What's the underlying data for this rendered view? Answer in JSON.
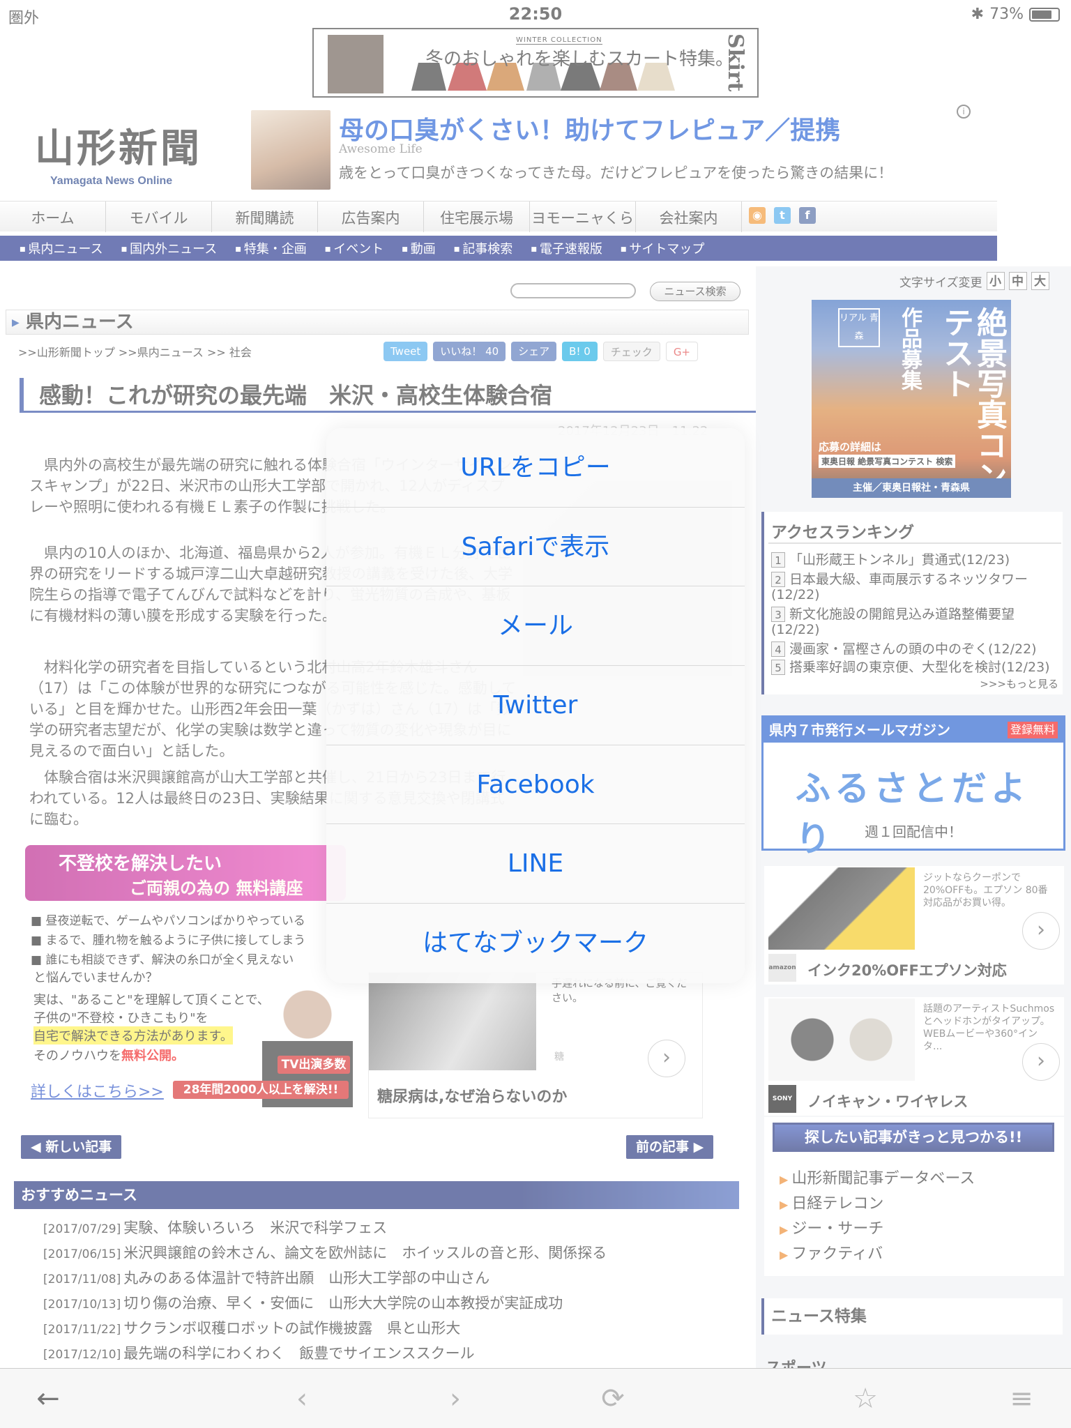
{
  "status_bar": {
    "carrier": "圏外",
    "time": "22:50",
    "battery": "73%"
  },
  "top_ad": {
    "collection": "WINTER COLLECTION",
    "title": "冬のおしゃれを楽しむスカート特集。",
    "side_text": "Skirt"
  },
  "header": {
    "logo_jp": "山形新聞",
    "logo_en": "Yamagata News Online",
    "ad": {
      "headline": "母の口臭がくさい！助けてフレピュア／提携",
      "source": "Awesome Life",
      "description": "歳をとって口臭がきつくなってきた母。だけどフレピュアを使ったら驚きの結果に！"
    }
  },
  "main_nav": [
    "ホーム",
    "モバイル",
    "新聞購読",
    "広告案内",
    "住宅展示場",
    "ヨモーニャくらぶ",
    "会社案内"
  ],
  "sub_nav": [
    "県内ニュース",
    "国内外ニュース",
    "特集・企画",
    "イベント",
    "動画",
    "記事検索",
    "電子速報版",
    "サイトマップ"
  ],
  "search": {
    "button": "ニュース検索"
  },
  "section_title": "県内ニュース",
  "breadcrumb": ">>山形新聞トップ >>県内ニュース >> 社会",
  "share_buttons": {
    "tweet": "Tweet",
    "like": "いいね！ 40",
    "share": "シェア",
    "hatena": "B! 0",
    "check": "チェック",
    "gplus": "G+"
  },
  "article": {
    "title": "感動！これが研究の最先端　米沢・高校生体験合宿",
    "date": "2017年12月23日　11:22",
    "paragraphs": [
      "　県内外の高校生が最先端の研究に触れる体験合宿「ウインターサイエンスキャンプ」が22日、米沢市の山形大工学部で開かれ、12人がディスプレーや照明に使われる有機ＥＬ素子の作製に挑戦した。",
      "　県内の10人のほか、北海道、福島県から2人が参加。有機ＥＬ分野で世界の研究をリードする城戸淳二山大卓越研究教授の講義を受けた後、大学院生らの指導で電子てんびんで試料などを計り、蛍光物質の合成や、基板に有機材料の薄い膜を形成する実験を行った。",
      "　材料化学の研究者を目指しているという北村山高2年鈴木雄斗さん（17）は「この体験が世界的な研究につながる可能性を感じた。感動している」と目を輝かせた。山形西2年会田一葉（かずは）さん（17）は「数学の研究者志望だが、化学の実験は数学と違って物質の変化や現象が目に見えるので面白い」と話した。",
      "　体験合宿は米沢興譲館高が山大工学部と共催し、21日から23日まで行われている。12人は最終日の23日、実験結果に関する意見交換や閉講式に臨む。"
    ]
  },
  "left_ad": {
    "title_a": "不登校を解決したい",
    "title_b": "ご両親の為の 無料講座",
    "bullets": [
      "昼夜逆転で、ゲームやパソコンばかりやっている",
      "まるで、腫れ物を触るように子供に接してしまう",
      "誰にも相談できず、解決の糸口が全く見えない"
    ],
    "line1": "と悩んでいませんか？",
    "line2": "実は、\"あること\"を理解して頂くことで、",
    "line3": "子供の\"不登校・ひきこもり\"を",
    "line4": "自宅で解決できる方法があります。",
    "line5a": "そのノウハウを",
    "line5b": "無料公開。",
    "badge_tv": "TV出演多数",
    "badge_result": "28年間2000人以上を解決!!",
    "link": "詳しくはこちら>>"
  },
  "mid_ad": {
    "text": "手遅れになる前に、ご覧ください。",
    "small": "糖",
    "headline": "糖尿病は,なぜ治らないのか"
  },
  "nav_buttons": {
    "newer": "新しい記事",
    "older": "前の記事"
  },
  "recommended": {
    "title": "おすすめニュース",
    "items": [
      {
        "date": "[2017/07/29]",
        "title": "実験、体験いろいろ　米沢で科学フェス"
      },
      {
        "date": "[2017/06/15]",
        "title": "米沢興譲館の鈴木さん、論文を欧州誌に　ホイッスルの音と形、関係探る"
      },
      {
        "date": "[2017/11/08]",
        "title": "丸みのある体温計で特許出願　山形大工学部の中山さん"
      },
      {
        "date": "[2017/10/13]",
        "title": "切り傷の治療、早く・安価に　山形大大学院の山本教授が実証成功"
      },
      {
        "date": "[2017/11/22]",
        "title": "サクランボ収穫ロボットの試作機披露　県と山形大"
      },
      {
        "date": "[2017/12/10]",
        "title": "最先端の科学にわくわく　飯豊でサイエンススクール"
      }
    ]
  },
  "sidebar": {
    "font_size_label": "文字サイズ変更",
    "font_sizes": [
      "小",
      "中",
      "大"
    ],
    "poster": {
      "logo": "リアル 青森",
      "title": "絶景写真コンテスト",
      "sub": "作品募集",
      "detail": "応募の詳細は",
      "search": "東奥日報 絶景写真コンテスト 検索",
      "host": "主催／東奥日報社・青森県"
    },
    "ranking": {
      "title": "アクセスランキング",
      "items": [
        {
          "n": "1",
          "text": "「山形蔵王トンネル」貫通式(12/23)"
        },
        {
          "n": "2",
          "text": "日本最大級、車両展示するネッツタワー(12/22)"
        },
        {
          "n": "3",
          "text": "新文化施設の開館見込み道路整備要望(12/22)"
        },
        {
          "n": "4",
          "text": "漫画家・冨樫さんの頭の中のぞく(12/22)"
        },
        {
          "n": "5",
          "text": "搭乗率好調の東京便、大型化を検討(12/23)"
        }
      ],
      "more": ">>>もっと見る"
    },
    "magazine": {
      "title": "県内７市発行メールマガジン",
      "register": "登録無料",
      "name": "ふるさとだより",
      "weekly": "週１回配信中！"
    },
    "ad1": {
      "text": "ジットならクーポンで20%OFFも。エプソン 80番対応品がお買い得。",
      "brand": "amazon",
      "headline": "インク20%OFFエプソン対応"
    },
    "ad2": {
      "text": "話題のアーティストSuchmosとヘッドホンがタイアップ。WEBムービーや360°インタ...",
      "brand": "SONY",
      "headline": "ノイキャン・ワイヤレス"
    },
    "search_box": {
      "title": "探したい記事がきっと見つかる!!",
      "links": [
        "山形新聞記事データベース",
        "日経テレコン",
        "ジー・サーチ",
        "ファクティバ"
      ]
    },
    "news_special": "ニュース特集",
    "sports": "スポーツ"
  },
  "share_sheet": [
    "URLをコピー",
    "Safariで表示",
    "メール",
    "Twitter",
    "Facebook",
    "LINE",
    "はてなブックマーク"
  ]
}
